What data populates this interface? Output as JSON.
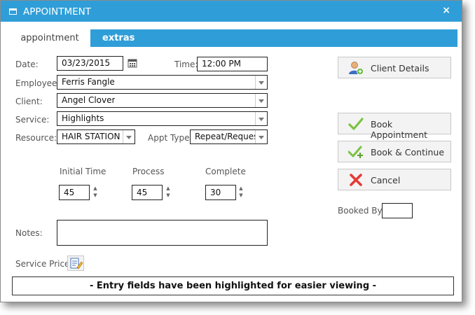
{
  "window": {
    "title": "APPOINTMENT",
    "close_label": "×"
  },
  "tabs": [
    {
      "label": "appointment"
    },
    {
      "label": "extras"
    }
  ],
  "form": {
    "date_label": "Date:",
    "date_value": "03/23/2015",
    "time_label": "Time:",
    "time_value": "12:00 PM",
    "employee_label": "Employee:",
    "employee_value": "Ferris Fangle",
    "client_label": "Client:",
    "client_value": "Angel Clover",
    "service_label": "Service:",
    "service_value": "Highlights",
    "resource_label": "Resource:",
    "resource_value": "HAIR STATION",
    "appt_type_label": "Appt Type:",
    "appt_type_value": "Repeat/Request",
    "initial_time_label": "Initial Time",
    "initial_time_value": "45",
    "process_label": "Process",
    "process_value": "45",
    "complete_label": "Complete",
    "complete_value": "30",
    "notes_label": "Notes:",
    "notes_value": "",
    "service_price_label": "Service Price:"
  },
  "actions": {
    "client_details": "Client Details",
    "book_appointment": "Book Appointment",
    "book_continue": "Book & Continue",
    "cancel": "Cancel",
    "booked_by_label": "Booked By:",
    "booked_by_value": ""
  },
  "notice": "- Entry fields have been highlighted for easier viewing -",
  "colors": {
    "accent": "#2f9ed8",
    "check": "#7cc242",
    "cancel": "#e53935"
  }
}
